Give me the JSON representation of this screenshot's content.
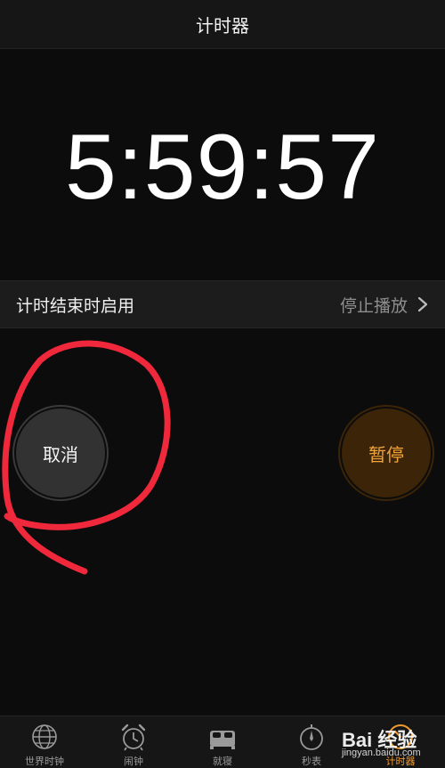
{
  "header": {
    "title": "计时器"
  },
  "timer": {
    "display": "5:59:57"
  },
  "end_row": {
    "label": "计时结束时启用",
    "value": "停止播放"
  },
  "buttons": {
    "cancel": "取消",
    "pause": "暂停"
  },
  "tabs": [
    {
      "label": "世界时钟",
      "icon": "globe-icon"
    },
    {
      "label": "闹钟",
      "icon": "alarm-clock-icon"
    },
    {
      "label": "就寝",
      "icon": "bed-icon"
    },
    {
      "label": "秒表",
      "icon": "stopwatch-icon"
    },
    {
      "label": "计时器",
      "icon": "timer-icon",
      "active": true
    }
  ],
  "watermark": {
    "brand": "Bai 经验",
    "url": "jingyan.baidu.com"
  },
  "colors": {
    "accent": "#f09a2e",
    "background": "#0c0c0c",
    "annotation": "#f0283c"
  }
}
